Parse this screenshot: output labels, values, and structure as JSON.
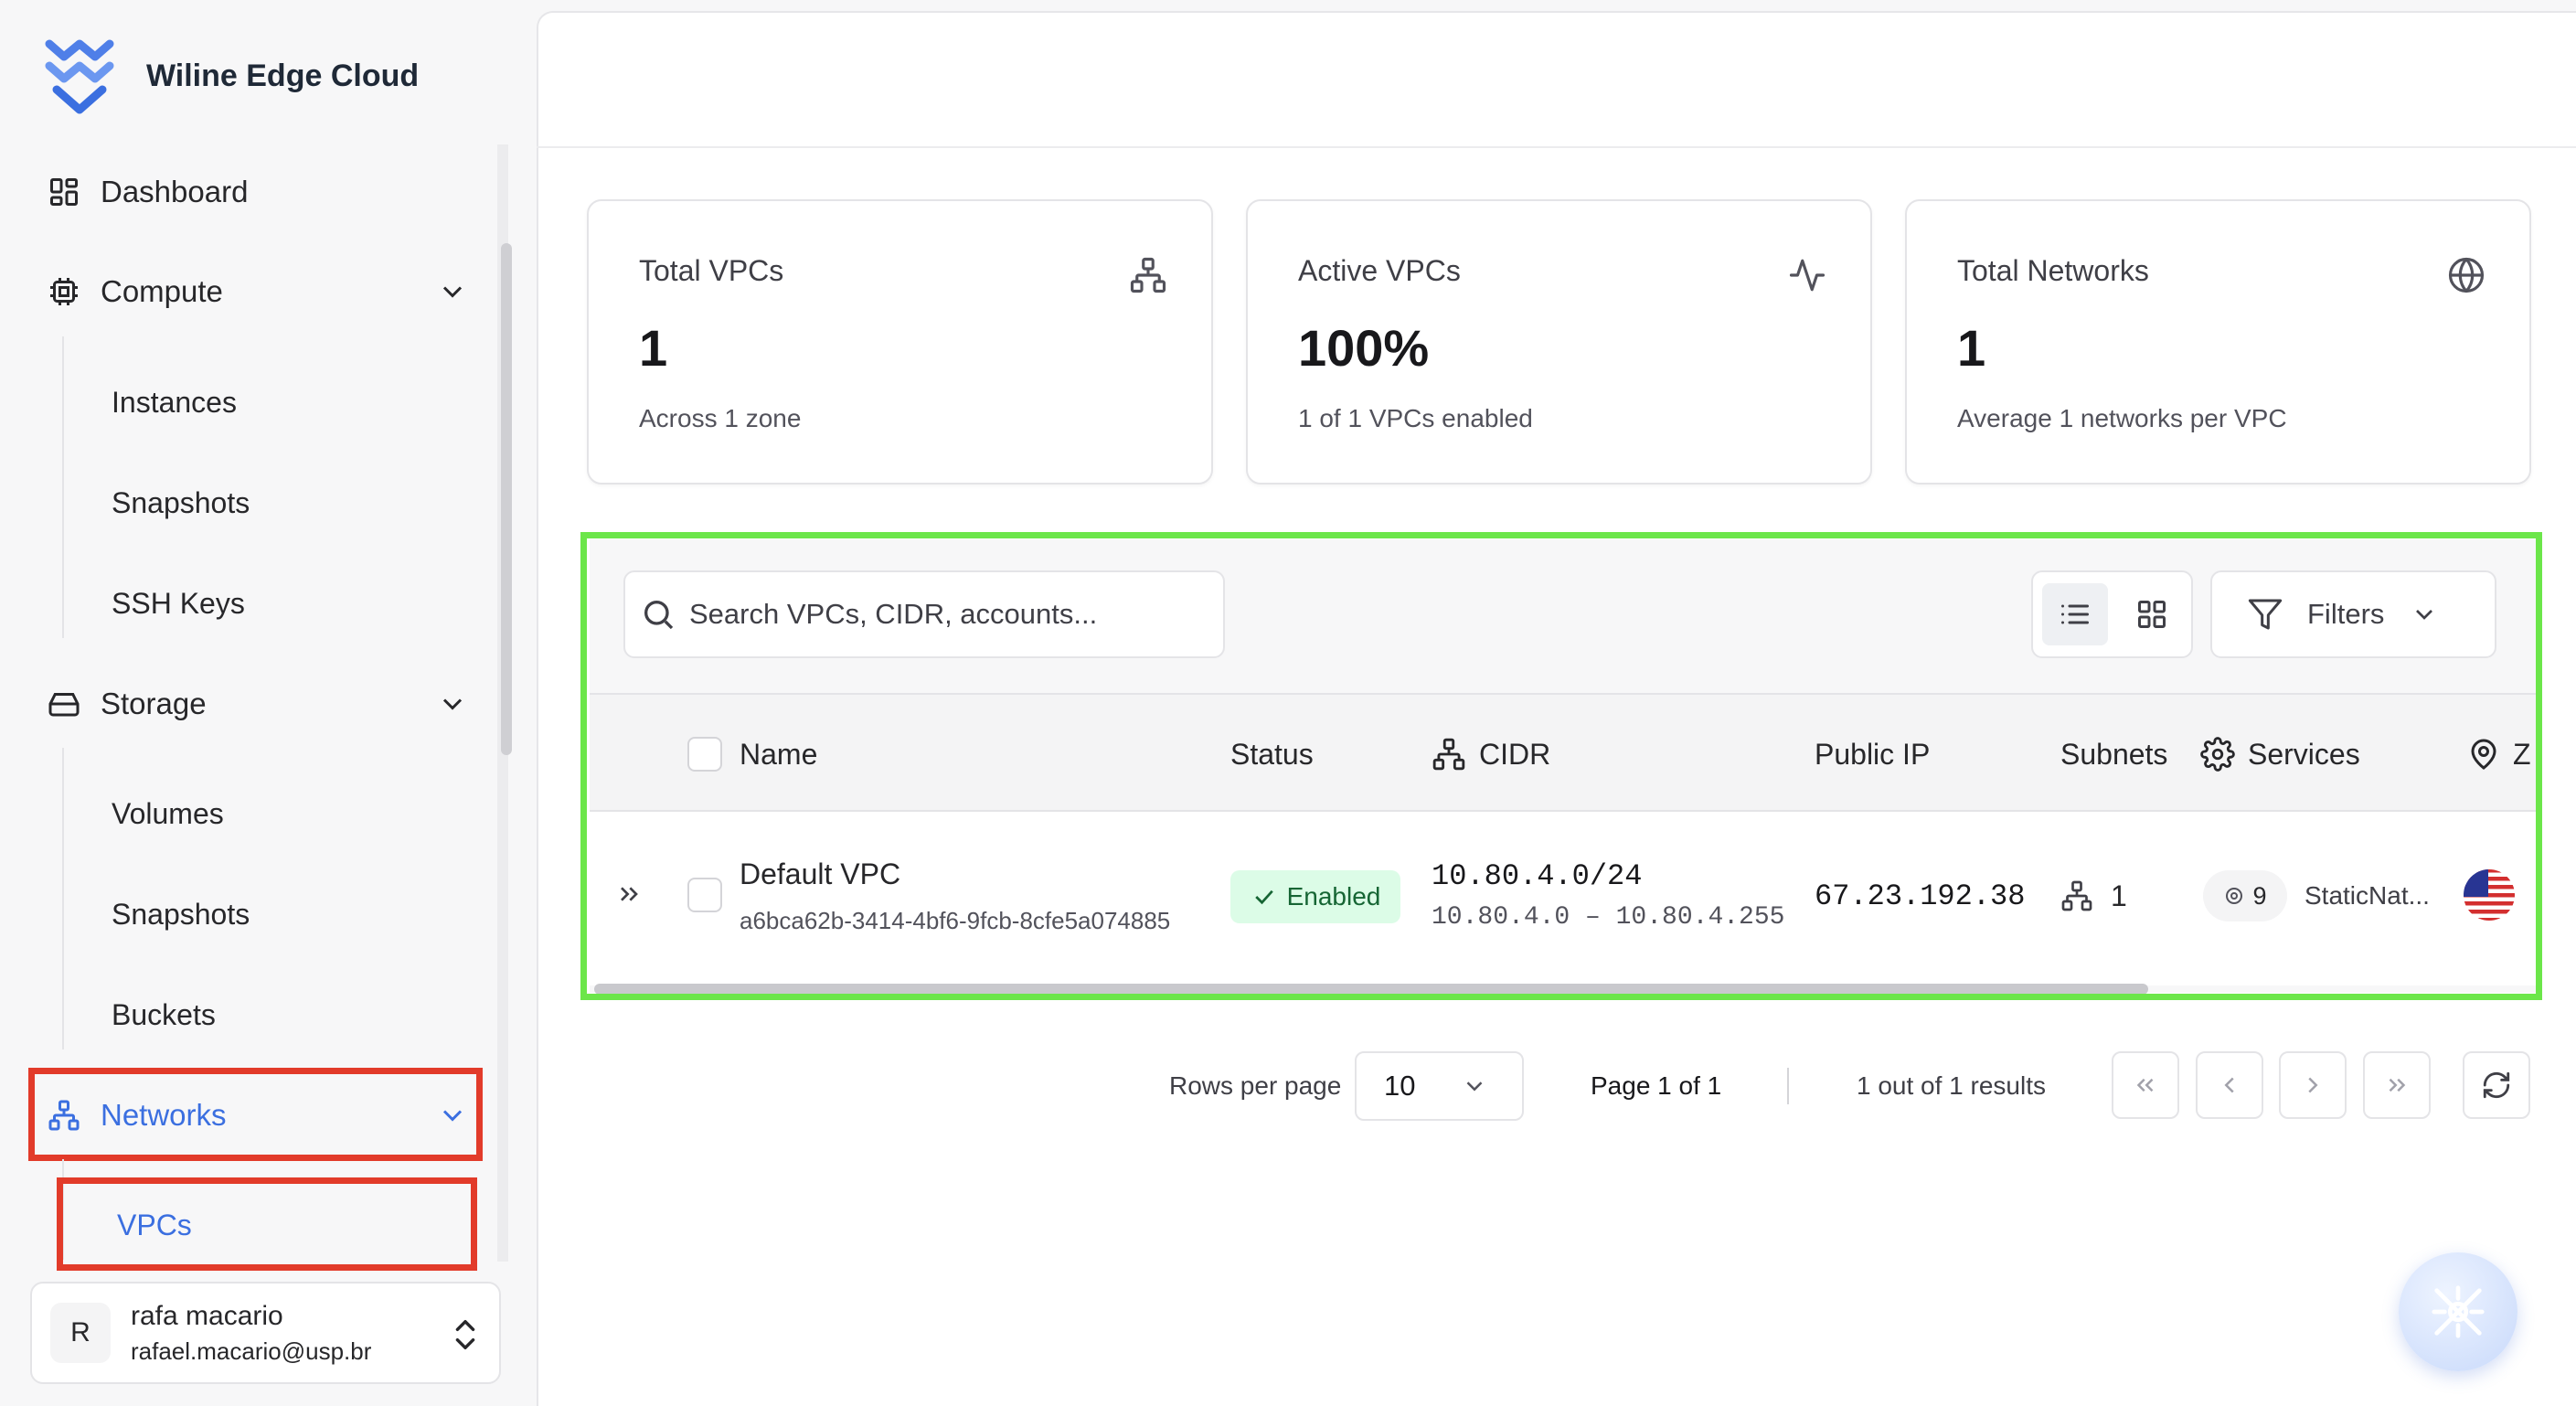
{
  "app": {
    "name": "Wiline Edge Cloud"
  },
  "sidebar": {
    "dashboard": "Dashboard",
    "compute": {
      "label": "Compute",
      "items": [
        "Instances",
        "Snapshots",
        "SSH Keys"
      ]
    },
    "storage": {
      "label": "Storage",
      "items": [
        "Volumes",
        "Snapshots",
        "Buckets"
      ]
    },
    "networks": {
      "label": "Networks",
      "items": [
        "VPCs"
      ]
    },
    "active_item": "VPCs"
  },
  "user": {
    "initial": "R",
    "name": "rafa macario",
    "email": "rafael.macario@usp.br"
  },
  "stats": [
    {
      "title": "Total VPCs",
      "value": "1",
      "sub": "Across 1 zone",
      "icon": "network-icon"
    },
    {
      "title": "Active VPCs",
      "value": "100%",
      "sub": "1 of 1 VPCs enabled",
      "icon": "activity-icon"
    },
    {
      "title": "Total Networks",
      "value": "1",
      "sub": "Average 1 networks per VPC",
      "icon": "globe-icon"
    }
  ],
  "toolbar": {
    "search_placeholder": "Search VPCs, CIDR, accounts...",
    "filters_label": "Filters",
    "view_mode": "list"
  },
  "table": {
    "columns": {
      "name": "Name",
      "status": "Status",
      "cidr": "CIDR",
      "public_ip": "Public IP",
      "subnets": "Subnets",
      "services": "Services",
      "zone": "Z"
    },
    "rows": [
      {
        "name": "Default VPC",
        "id": "a6bca62b-3414-4bf6-9fcb-8cfe5a074885",
        "status": "Enabled",
        "cidr": "10.80.4.0/24",
        "cidr_range": "10.80.4.0 – 10.80.4.255",
        "public_ip": "67.23.192.38",
        "subnets": "1",
        "services_count": "9",
        "services_text": "StaticNat...",
        "zone_flag": "us-flag-icon"
      }
    ]
  },
  "pagination": {
    "rows_per_page_label": "Rows per page",
    "rows_per_page": "10",
    "page_label": "Page 1 of 1",
    "results_label": "1 out of 1 results"
  },
  "colors": {
    "accent": "#3b6fe0",
    "highlight_red": "#e23b2a",
    "highlight_green": "#6ce64a",
    "enabled_bg": "#dcfce7",
    "enabled_fg": "#166534"
  }
}
